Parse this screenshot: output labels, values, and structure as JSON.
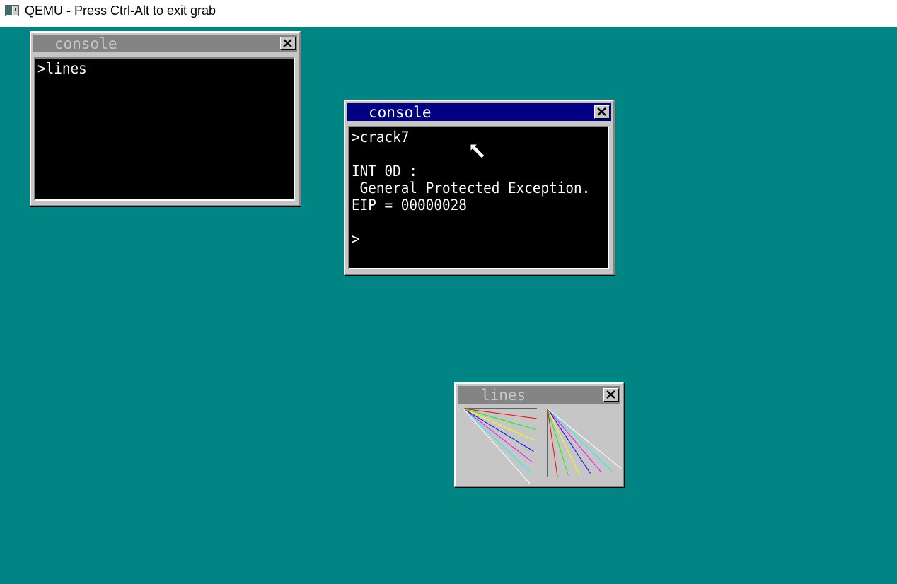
{
  "host_window": {
    "title": "QEMU - Press Ctrl-Alt to exit grab",
    "icon": "qemu-app-icon"
  },
  "desktop": {
    "background_color": "#008484"
  },
  "windows": {
    "console_1": {
      "title": "console",
      "state": "inactive",
      "lines": [
        ">lines"
      ]
    },
    "console_2": {
      "title": "console",
      "state": "active",
      "lines": [
        ">crack7",
        "",
        "INT 0D :",
        " General Protected Exception.",
        "EIP = 00000028",
        "",
        ">"
      ]
    },
    "lines_window": {
      "title": "lines",
      "state": "inactive",
      "line_colors": [
        "#ff0000",
        "#00ff00",
        "#ffff00",
        "#0000ff",
        "#ff00ff",
        "#00ffff",
        "#ffffff"
      ]
    }
  },
  "colors": {
    "title_active": "#000084",
    "title_inactive": "#848484",
    "window_face": "#c6c6c6"
  }
}
